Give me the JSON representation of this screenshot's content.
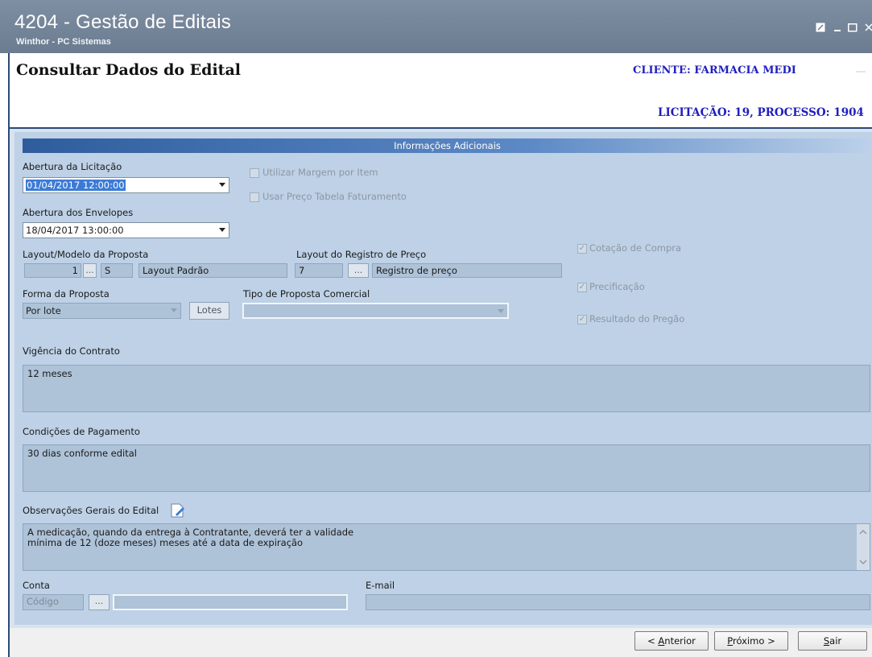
{
  "window": {
    "title": "4204 - Gestão de Editais",
    "subtitle": "Winthor - PC Sistemas",
    "controls": [
      "restore-icon",
      "minimize-icon",
      "maximize-icon",
      "close-icon"
    ]
  },
  "header": {
    "page_title": "Consultar Dados do Edital",
    "client": "CLIENTE: FARMACIA MEDI",
    "licitacao": "LICITAÇÃO: 19, PROCESSO: 1904"
  },
  "section": {
    "title": "Informações Adicionais"
  },
  "form": {
    "abertura_licitacao": {
      "label": "Abertura da Licitação",
      "value": "01/04/2017 12:00:00"
    },
    "abertura_envelopes": {
      "label": "Abertura dos Envelopes",
      "value": "18/04/2017 13:00:00"
    },
    "utilizar_margem": {
      "label": "Utilizar Margem por Item",
      "checked": false
    },
    "usar_preco_tabela": {
      "label": "Usar Preço Tabela Faturamento",
      "checked": false
    },
    "layout_modelo": {
      "label": "Layout/Modelo da Proposta",
      "code": "1",
      "button": "...",
      "type": "S",
      "name": "Layout Padrão"
    },
    "layout_registro": {
      "label": "Layout do Registro de Preço",
      "code": "7",
      "button": "...",
      "name": "Registro de preço"
    },
    "forma_proposta": {
      "label": "Forma da Proposta",
      "value": "Por lote",
      "lotes_button": "Lotes"
    },
    "tipo_proposta": {
      "label": "Tipo de Proposta Comercial",
      "value": ""
    },
    "cotacao_compra": {
      "label": "Cotação de Compra",
      "checked": true
    },
    "precificacao": {
      "label": "Precificação",
      "checked": true
    },
    "resultado_pregao": {
      "label": "Resultado do Pregão",
      "checked": true
    },
    "vigencia": {
      "label": "Vigência do Contrato",
      "value": "12 meses"
    },
    "condicoes": {
      "label": "Condições de Pagamento",
      "value": "30 dias conforme edital"
    },
    "observacoes": {
      "label": "Observações Gerais do Edital",
      "value": "A medicação, quando da entrega à Contratante, deverá ter a validade\nmínima de 12 (doze meses) meses até a data de expiração"
    },
    "conta": {
      "label": "Conta",
      "placeholder": "Código",
      "button": "...",
      "value": ""
    },
    "email": {
      "label": "E-mail",
      "value": ""
    }
  },
  "footer": {
    "anterior": {
      "prefix": "< ",
      "mnemonic": "A",
      "rest": "nterior"
    },
    "proximo": {
      "mnemonic": "P",
      "rest": "róximo >"
    },
    "sair": {
      "mnemonic": "S",
      "rest": "air"
    }
  }
}
